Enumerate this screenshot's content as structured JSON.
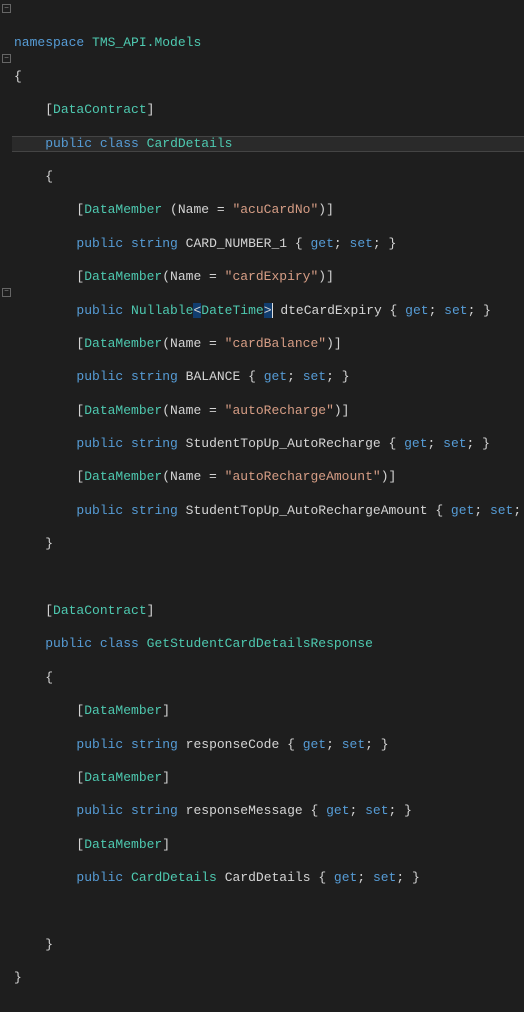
{
  "ns": {
    "kw": "namespace",
    "name": "TMS_API.Models"
  },
  "braces": {
    "open": "{",
    "close": "}"
  },
  "attrs": {
    "contract": "DataContract",
    "member": "DataMember",
    "nameEq": "Name = "
  },
  "kw": {
    "public": "public",
    "class": "class",
    "string": "string",
    "get": "get",
    "set": "set",
    "nullable": "Nullable",
    "datetime": "DateTime"
  },
  "class1": {
    "name": "CardDetails",
    "members": [
      {
        "attrName": "\"acuCardNo\"",
        "type": "string",
        "prop": "CARD_NUMBER_1"
      },
      {
        "attrName": "\"cardExpiry\"",
        "type": "nullable",
        "prop": "dteCardExpiry"
      },
      {
        "attrName": "\"cardBalance\"",
        "type": "string",
        "prop": "BALANCE"
      },
      {
        "attrName": "\"autoRecharge\"",
        "type": "string",
        "prop": "StudentTopUp_AutoRecharge"
      },
      {
        "attrName": "\"autoRechargeAmount\"",
        "type": "string",
        "prop": "StudentTopUp_AutoRechargeAmount"
      }
    ]
  },
  "class2": {
    "name": "GetStudentCardDetailsResponse",
    "members": [
      {
        "type": "string",
        "prop": "responseCode"
      },
      {
        "type": "string",
        "prop": "responseMessage"
      },
      {
        "type": "CardDetails",
        "prop": "CardDetails"
      }
    ]
  },
  "chart_data": null
}
